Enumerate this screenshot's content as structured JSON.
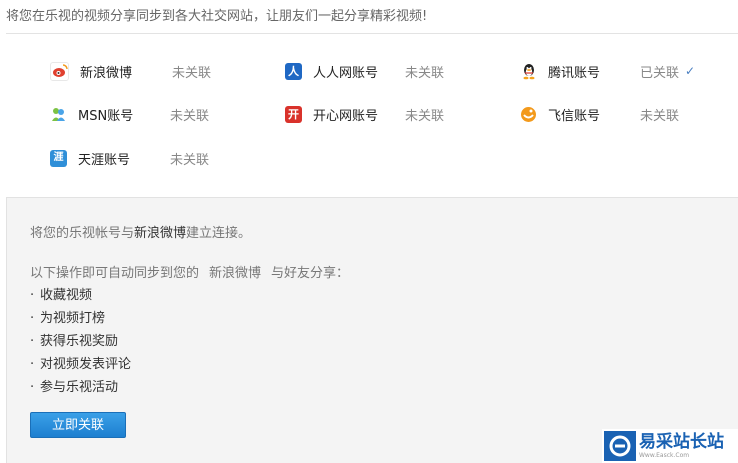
{
  "intro": "将您在乐视的视频分享同步到各大社交网站，让朋友们一起分享精彩视频!",
  "accounts": [
    {
      "name": "新浪微博",
      "status": "未关联",
      "icon": "sina-weibo-icon",
      "color": "#e0402f",
      "glyph": "◉"
    },
    {
      "name": "人人网账号",
      "status": "未关联",
      "icon": "renren-icon",
      "color": "#1f68c4",
      "glyph": "人"
    },
    {
      "name": "腾讯账号",
      "status": "已关联",
      "icon": "qq-penguin-icon",
      "color": "#ffffff",
      "glyph": "🐧"
    },
    {
      "name": "MSN账号",
      "status": "未关联",
      "icon": "msn-icon",
      "color": "#4aa4e8",
      "glyph": "✱"
    },
    {
      "name": "开心网账号",
      "status": "未关联",
      "icon": "kaixin-icon",
      "color": "#d9322b",
      "glyph": "开"
    },
    {
      "name": "飞信账号",
      "status": "未关联",
      "icon": "fetion-icon",
      "color": "#f39a1c",
      "glyph": "◐"
    },
    {
      "name": "天涯账号",
      "status": "未关联",
      "icon": "tianya-icon",
      "color": "#2f8fd8",
      "glyph": "涯"
    }
  ],
  "linked_check": "✓",
  "panel": {
    "connect_prefix": "将您的乐视帐号与",
    "connect_platform": "新浪微博",
    "connect_suffix": "建立连接。",
    "ops_prefix": "以下操作即可自动同步到您的",
    "ops_platform": "新浪微博",
    "ops_suffix": "与好友分享：",
    "benefits": [
      "收藏视频",
      "为视频打榜",
      "获得乐视奖励",
      "对视频发表评论",
      "参与乐视活动"
    ],
    "button": "立即关联"
  },
  "watermark": {
    "title": "易采站长站",
    "subtitle": "Www.Easck.Com"
  }
}
